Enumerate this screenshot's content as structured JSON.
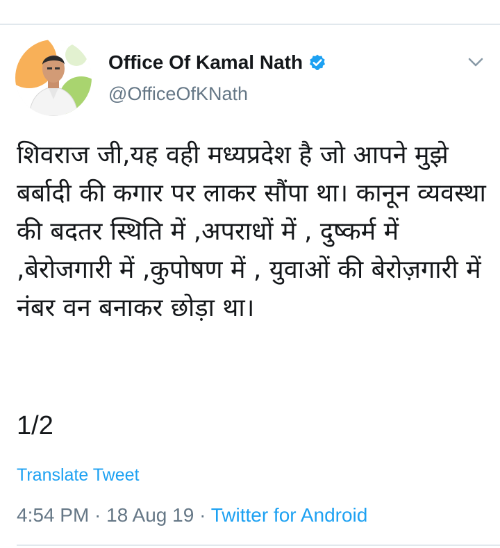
{
  "tweet": {
    "display_name": "Office Of Kamal Nath",
    "handle": "@OfficeOfKNath",
    "text": "शिवराज जी,यह वही मध्यप्रदेश है जो आपने मुझे बर्बादी की कगार पर लाकर सौंपा था। कानून व्यवस्था की बदतर स्थिति में ,अपराधों में , दुष्कर्म में ,बेरोजगारी में ,कुपोषण में , युवाओं की बेरोज़गारी में नंबर वन बनाकर छोड़ा था।",
    "thread_count": "1/2",
    "translate_label": "Translate Tweet",
    "time": "4:54 PM",
    "separator": " · ",
    "date": "18 Aug 19",
    "source": "Twitter for Android"
  },
  "icons": {
    "verified": "verified-badge-icon",
    "chevron": "chevron-down-icon"
  },
  "colors": {
    "accent": "#1da1f2",
    "secondary_text": "#657786",
    "divider": "#e1e8ed"
  }
}
